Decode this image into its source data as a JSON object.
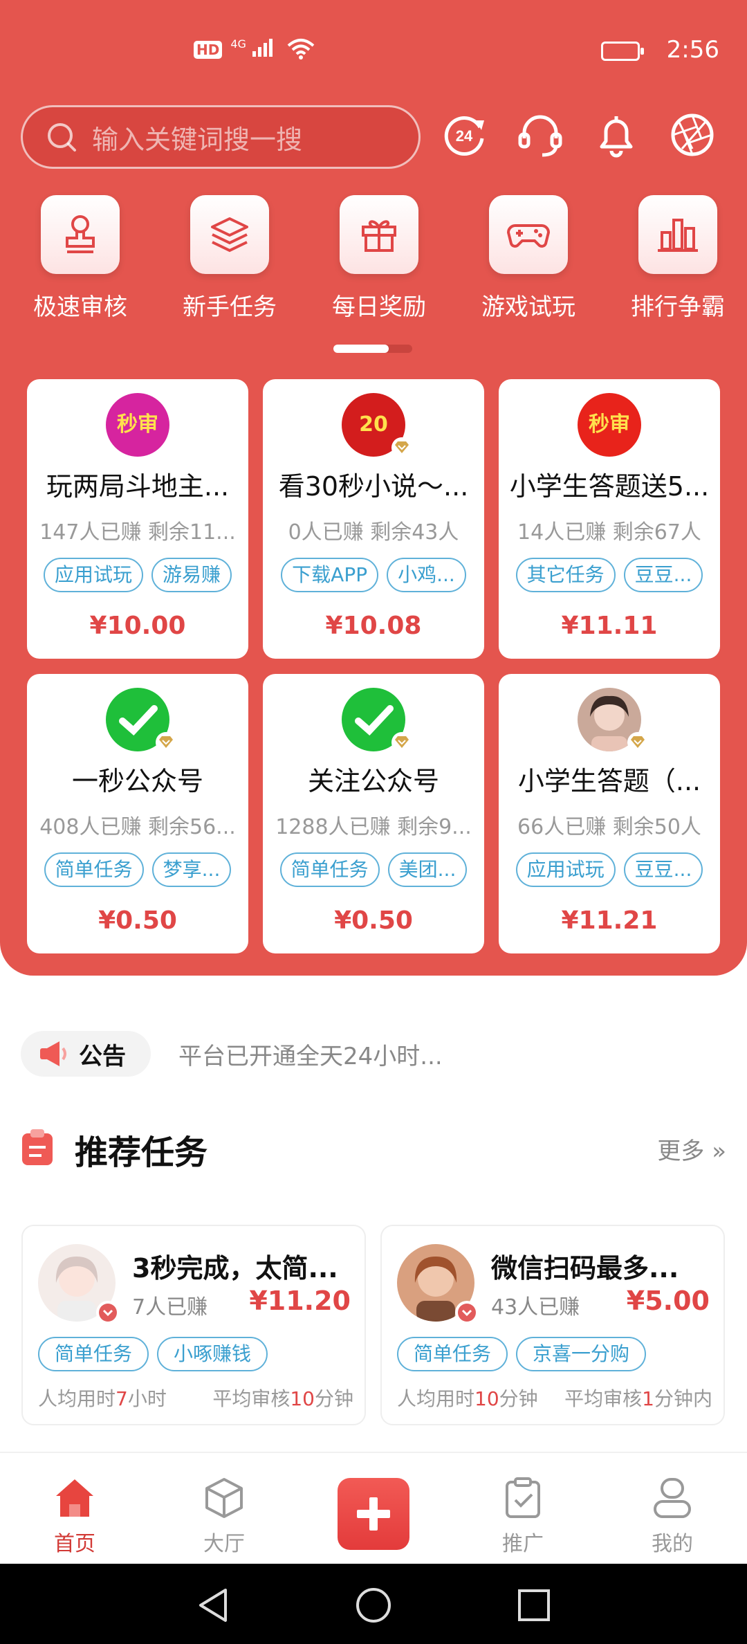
{
  "status_bar": {
    "time": "2:56",
    "network": "4G",
    "hd": "HD"
  },
  "search": {
    "placeholder": "输入关键词搜一搜"
  },
  "header_icons": [
    "24h-refresh-icon",
    "customer-service-icon",
    "bell-icon",
    "shutter-icon"
  ],
  "categories": [
    {
      "label": "极速审核",
      "icon": "stamp-icon"
    },
    {
      "label": "新手任务",
      "icon": "layers-icon"
    },
    {
      "label": "每日奖励",
      "icon": "gift-icon"
    },
    {
      "label": "游戏试玩",
      "icon": "gamepad-icon"
    },
    {
      "label": "排行争霸",
      "icon": "bar-chart-icon"
    }
  ],
  "pager": {
    "pages": 2,
    "current": 1
  },
  "featured_tasks": [
    {
      "title": "玩两局斗地主...",
      "stats": "147人已赚  剩余11...",
      "tags": [
        "应用试玩",
        "游易赚"
      ],
      "price": "¥10.00",
      "avatar": "秒审",
      "avatar_color": "#d6249f"
    },
    {
      "title": "看30秒小说～...",
      "stats": "0人已赚  剩余43人",
      "tags": [
        "下载APP",
        "小鸡..."
      ],
      "price": "¥10.08",
      "avatar": "20",
      "avatar_color": "#d31d1d"
    },
    {
      "title": "小学生答题送5...",
      "stats": "14人已赚  剩余67人",
      "tags": [
        "其它任务",
        "豆豆..."
      ],
      "price": "¥11.11",
      "avatar": "秒审",
      "avatar_color": "#e8231b"
    },
    {
      "title": "一秒公众号",
      "stats": "408人已赚  剩余56...",
      "tags": [
        "简单任务",
        "梦享..."
      ],
      "price": "¥0.50",
      "avatar": "",
      "avatar_color": "#1fbf3a"
    },
    {
      "title": "关注公众号",
      "stats": "1288人已赚  剩余9...",
      "tags": [
        "简单任务",
        "美团..."
      ],
      "price": "¥0.50",
      "avatar": "",
      "avatar_color": "#1fbf3a"
    },
    {
      "title": "小学生答题（...",
      "stats": "66人已赚  剩余50人",
      "tags": [
        "应用试玩",
        "豆豆..."
      ],
      "price": "¥11.21",
      "avatar": "",
      "avatar_color": "#caa99a"
    }
  ],
  "notice": {
    "label": "公告",
    "text": "平台已开通全天24小时..."
  },
  "recommended": {
    "title": "推荐任务",
    "more": "更多",
    "items": [
      {
        "title": "3秒完成，太简...",
        "count": "7人已赚",
        "price": "¥11.20",
        "tags": [
          "简单任务",
          "小啄赚钱"
        ],
        "avg_time_prefix": "人均用时",
        "avg_time_value": "7",
        "avg_time_unit": "小时",
        "review_prefix": "平均审核",
        "review_value": "10",
        "review_unit": "分钟"
      },
      {
        "title": "微信扫码最多...",
        "count": "43人已赚",
        "price": "¥5.00",
        "tags": [
          "简单任务",
          "京喜一分购"
        ],
        "avg_time_prefix": "人均用时",
        "avg_time_value": "10",
        "avg_time_unit": "分钟",
        "review_prefix": "平均审核",
        "review_value": "1",
        "review_unit": "分钟内"
      }
    ]
  },
  "tabbar": {
    "home": "首页",
    "hall": "大厅",
    "promote": "推广",
    "mine": "我的"
  },
  "colors": {
    "primary": "#e4554e",
    "price": "#e04646",
    "tag": "#3a9fcf"
  }
}
